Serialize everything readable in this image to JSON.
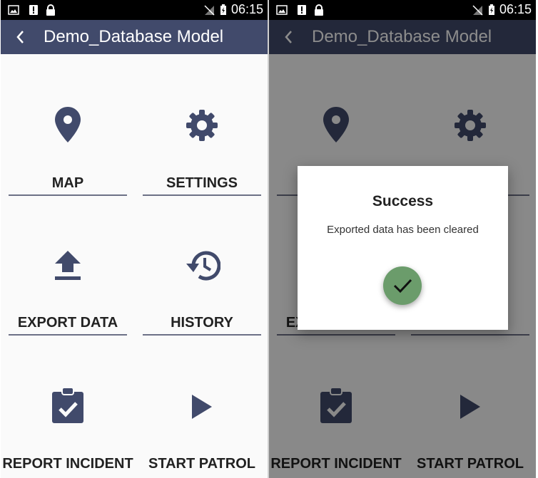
{
  "status_bar": {
    "time": "06:15"
  },
  "app_bar": {
    "title": "Demo_Database Model"
  },
  "tiles": {
    "map": "MAP",
    "settings": "SETTINGS",
    "export": "EXPORT DATA",
    "history": "HISTORY",
    "report": "REPORT INCIDENT",
    "patrol": "START PATROL"
  },
  "dialog": {
    "title": "Success",
    "message": "Exported data has been cleared",
    "icon": "check-icon",
    "accent_color": "#6b9c6b"
  },
  "colors": {
    "app_bar": "#414a6b",
    "icon": "#414a6b"
  }
}
